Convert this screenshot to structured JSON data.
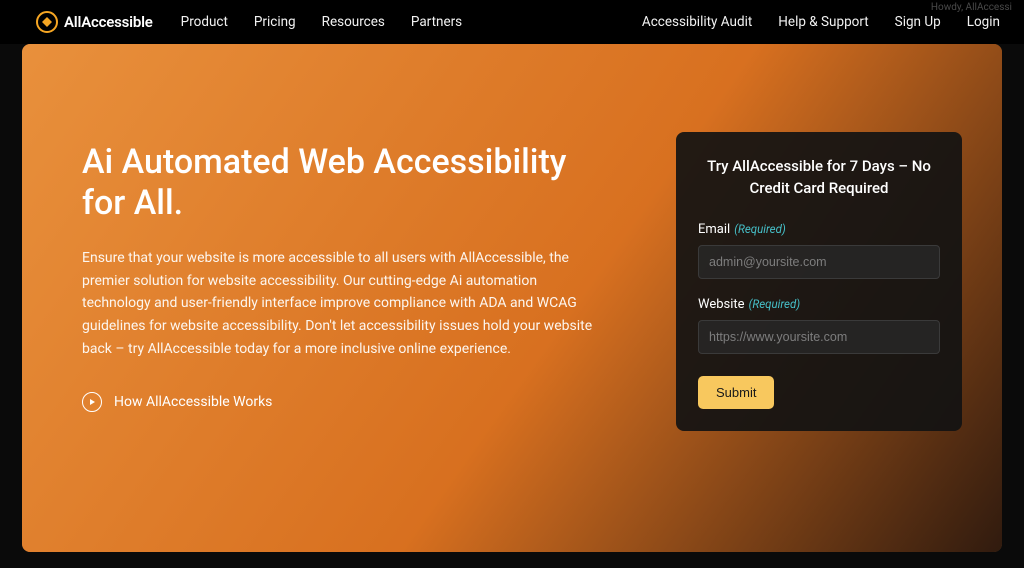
{
  "greeting": "Howdy, AllAccessi",
  "brand": {
    "name": "AllAccessible"
  },
  "nav": {
    "left": [
      {
        "label": "Product"
      },
      {
        "label": "Pricing"
      },
      {
        "label": "Resources"
      },
      {
        "label": "Partners"
      }
    ],
    "right": [
      {
        "label": "Accessibility Audit"
      },
      {
        "label": "Help & Support"
      },
      {
        "label": "Sign Up"
      },
      {
        "label": "Login"
      }
    ]
  },
  "hero": {
    "headline": "Ai Automated Web Accessibility for All.",
    "subcopy": "Ensure that your website is more accessible to all users with AllAccessible, the premier solution for website accessibility. Our cutting-edge Ai automation technology and user-friendly interface improve compliance with ADA and WCAG guidelines for website accessibility. Don't let accessibility issues hold your website back – try AllAccessible today for a more inclusive online experience.",
    "how_link": "How AllAccessible Works"
  },
  "form": {
    "title": "Try AllAccessible for 7 Days – No Credit Card Required",
    "email_label": "Email",
    "website_label": "Website",
    "required_text": "(Required)",
    "email_placeholder": "admin@yoursite.com",
    "website_placeholder": "https://www.yoursite.com",
    "submit_label": "Submit"
  }
}
